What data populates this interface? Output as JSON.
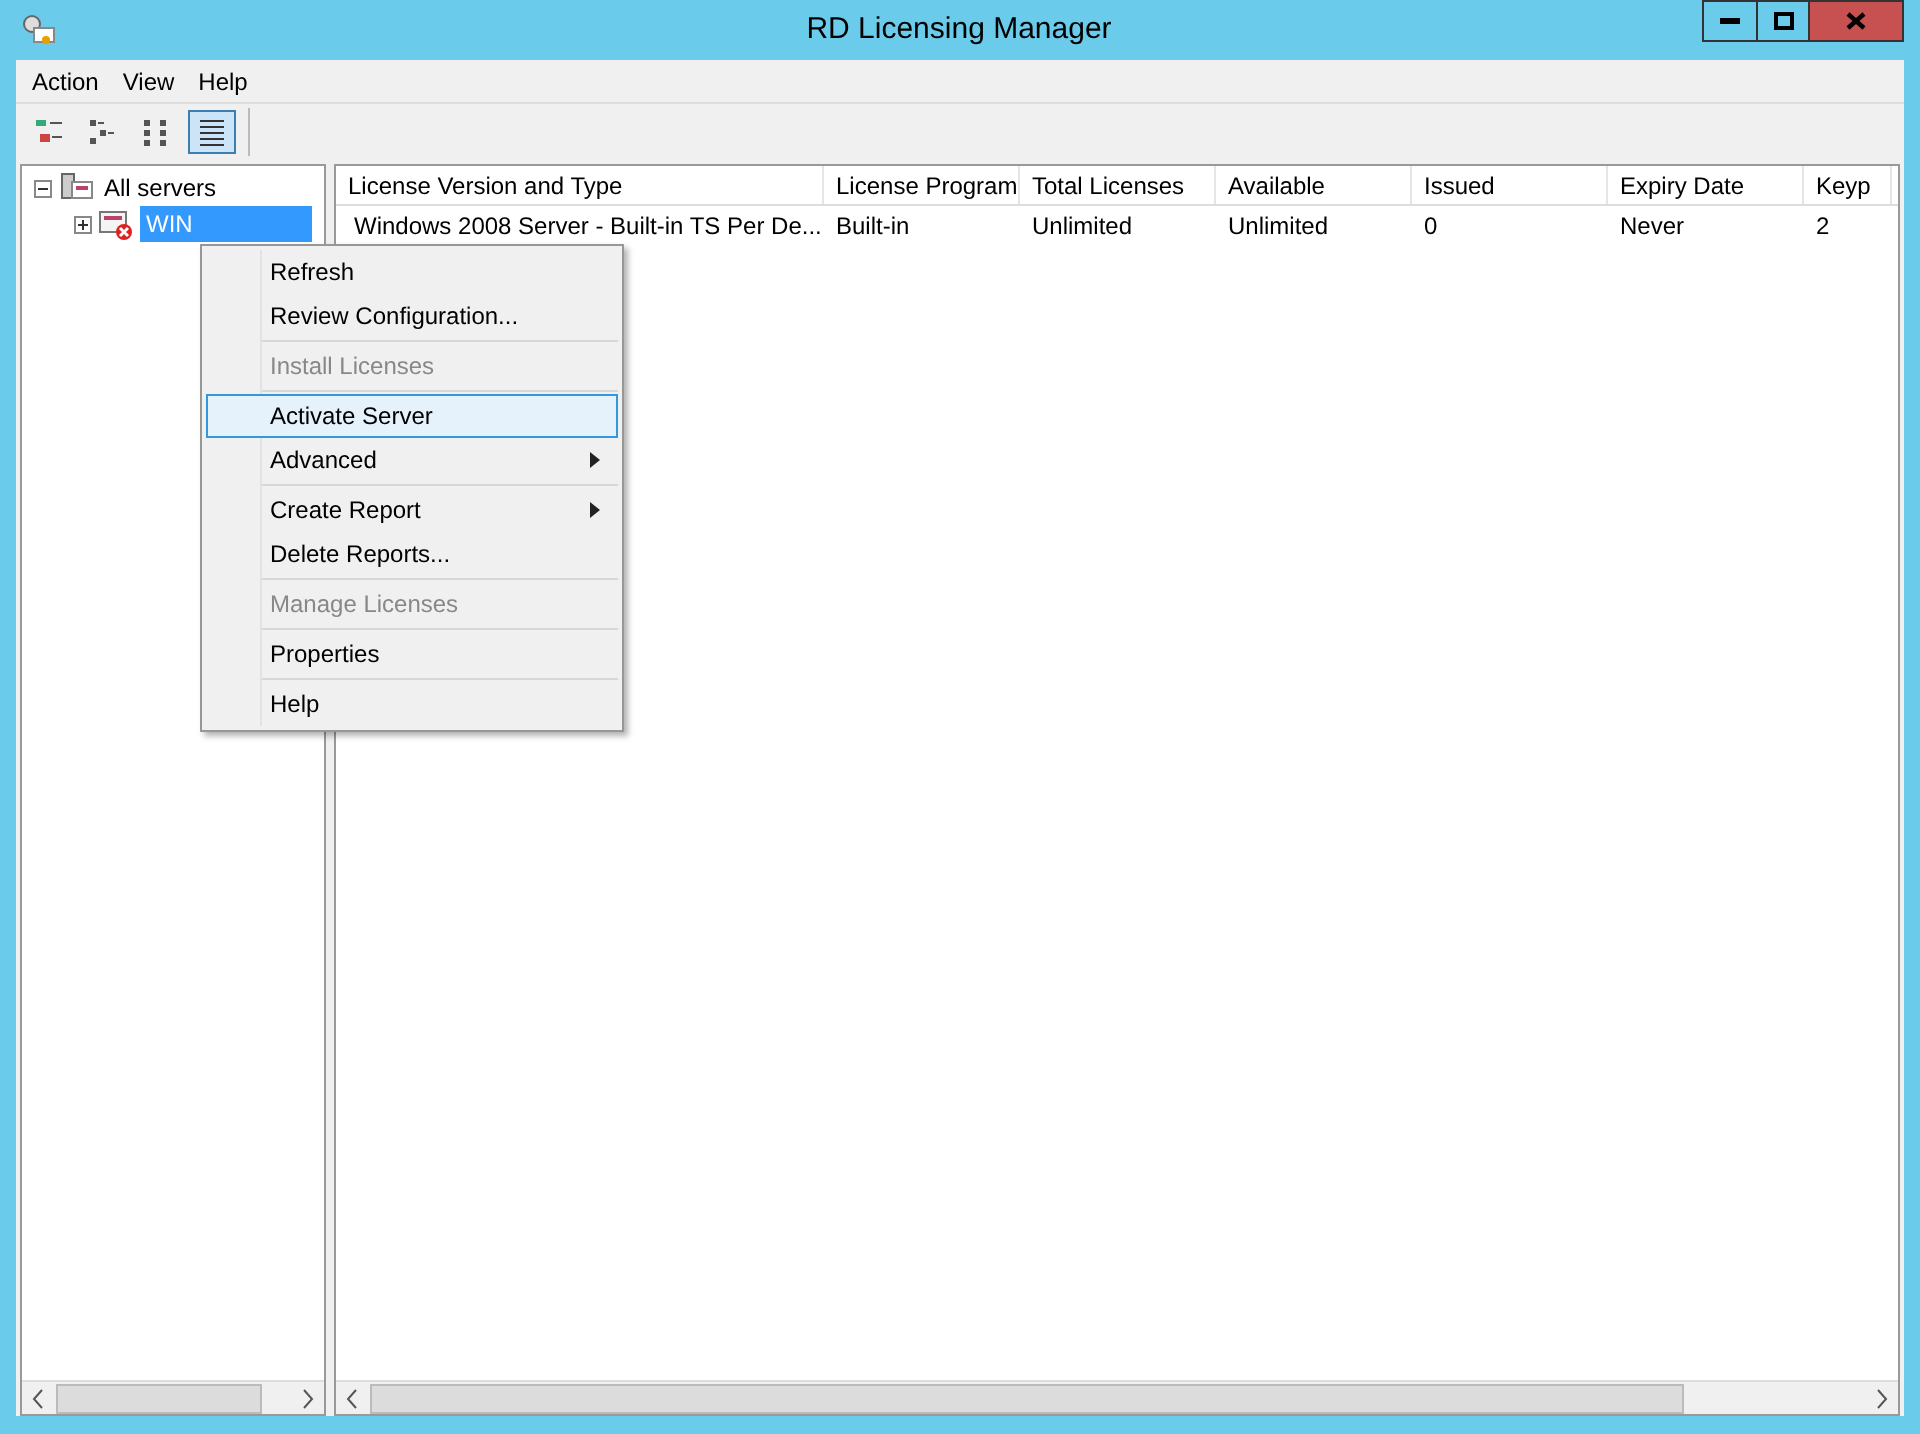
{
  "window": {
    "title": "RD Licensing Manager"
  },
  "menu_bar": [
    "Action",
    "View",
    "Help"
  ],
  "toolbar": [
    {
      "kind": "tree",
      "selected": false
    },
    {
      "kind": "list",
      "selected": false
    },
    {
      "kind": "small",
      "selected": false
    },
    {
      "kind": "details",
      "selected": true
    }
  ],
  "tree": {
    "label": "All servers",
    "expanded": true,
    "children": [
      {
        "label": "WIN",
        "selected": true,
        "expanded": false,
        "error": true
      }
    ]
  },
  "table": {
    "columns": [
      "License Version and Type",
      "License Program",
      "Total Licenses",
      "Available",
      "Issued",
      "Expiry Date",
      "Keyp"
    ],
    "rows": [
      [
        "Windows 2008 Server - Built-in TS Per De...",
        "Built-in",
        "Unlimited",
        "Unlimited",
        "0",
        "Never",
        "2"
      ]
    ]
  },
  "context_menu": [
    {
      "label": "Refresh",
      "disabled": false,
      "selected": false,
      "submenu": false
    },
    {
      "label": "Review Configuration...",
      "disabled": false,
      "selected": false,
      "submenu": false
    },
    {
      "label": "Install Licenses",
      "disabled": true,
      "selected": false,
      "submenu": false
    },
    {
      "label": "Activate Server",
      "disabled": false,
      "selected": true,
      "submenu": false
    },
    {
      "label": "Advanced",
      "disabled": false,
      "selected": false,
      "submenu": true
    },
    {
      "label": "Create Report",
      "disabled": false,
      "selected": false,
      "submenu": true
    },
    {
      "label": "Delete Reports...",
      "disabled": false,
      "selected": false,
      "submenu": false
    },
    {
      "label": "Manage Licenses",
      "disabled": true,
      "selected": false,
      "submenu": false
    },
    {
      "label": "Properties",
      "disabled": false,
      "selected": false,
      "submenu": false
    },
    {
      "label": "Help",
      "disabled": false,
      "selected": false,
      "submenu": false
    }
  ]
}
